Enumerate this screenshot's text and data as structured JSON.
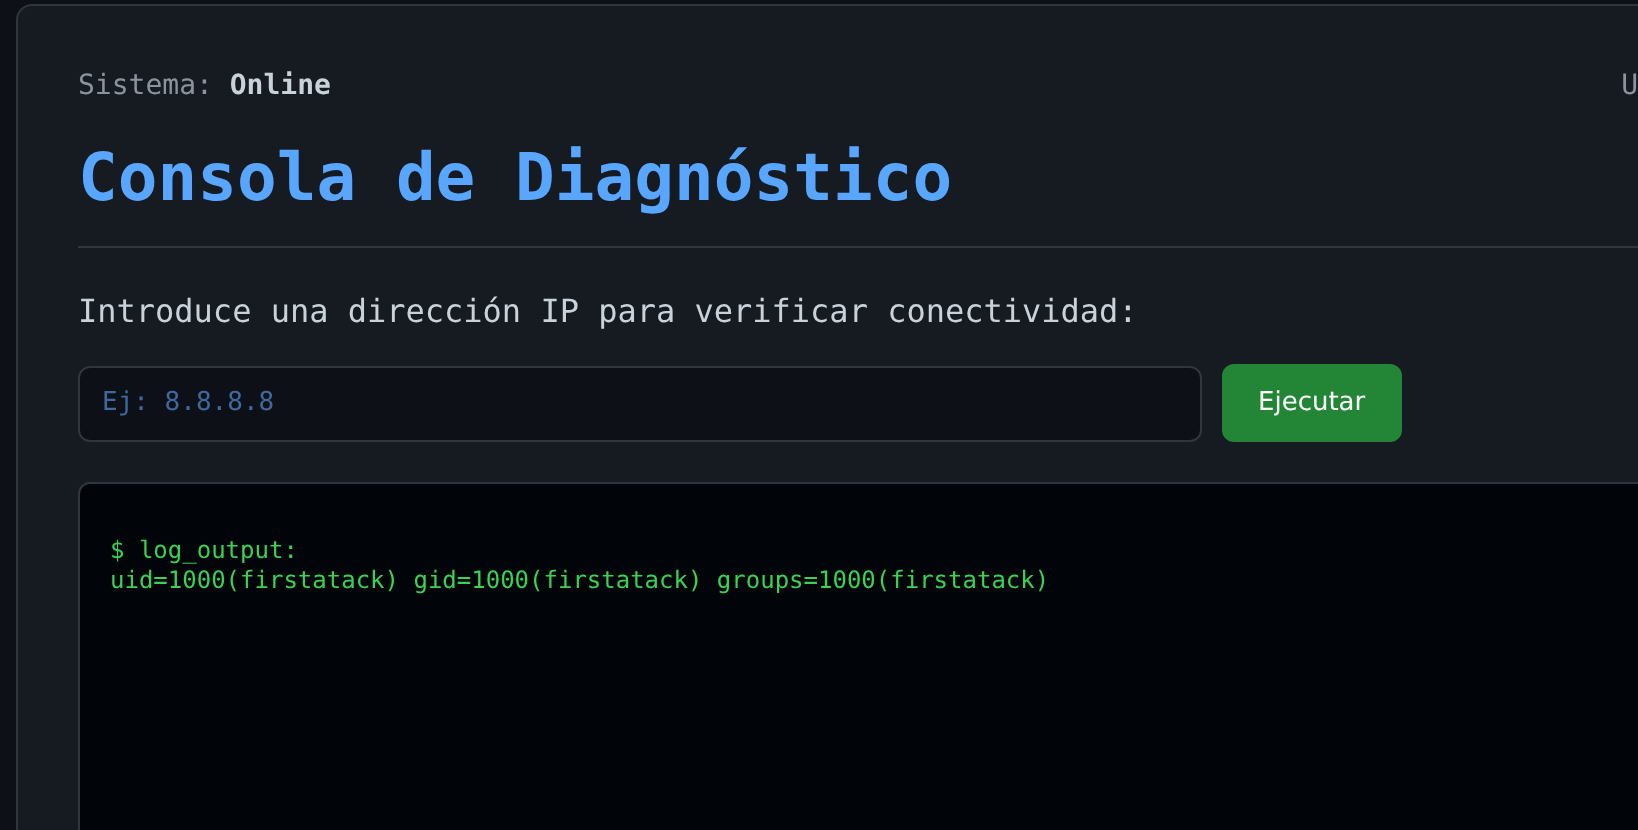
{
  "status": {
    "label": "Sistema:",
    "value": "Online",
    "right_text": "U"
  },
  "title": "Consola de Diagnóstico",
  "prompt": "Introduce una dirección IP para verificar conectividad:",
  "ip_field": {
    "placeholder": "Ej: 8.8.8.8"
  },
  "run_button": "Ejecutar",
  "console": {
    "lines": [
      "$ log_output:",
      "uid=1000(firstatack) gid=1000(firstatack) groups=1000(firstatack)"
    ]
  }
}
